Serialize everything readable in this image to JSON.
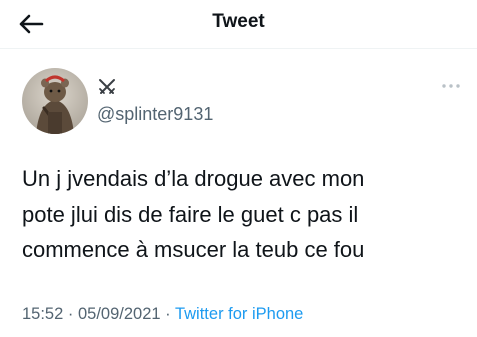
{
  "header": {
    "back_icon": "arrow-left-icon",
    "title": "Tweet"
  },
  "author": {
    "display_name_icon": "crossed-swords-icon",
    "handle": "@splinter9131",
    "avatar_icon": "rat-avatar-icon"
  },
  "more_icon": "ellipsis-icon",
  "tweet": {
    "lines": [
      "Un j jvendais d’la drogue avec mon",
      "pote jlui dis de faire le guet c pas il",
      "commence à msucer la teub ce fou"
    ]
  },
  "meta": {
    "time": "15:52",
    "separator": "·",
    "date": "05/09/2021",
    "source": "Twitter for iPhone"
  },
  "colors": {
    "text": "#0f1419",
    "secondary": "#536471",
    "accent": "#1d9bf0"
  }
}
